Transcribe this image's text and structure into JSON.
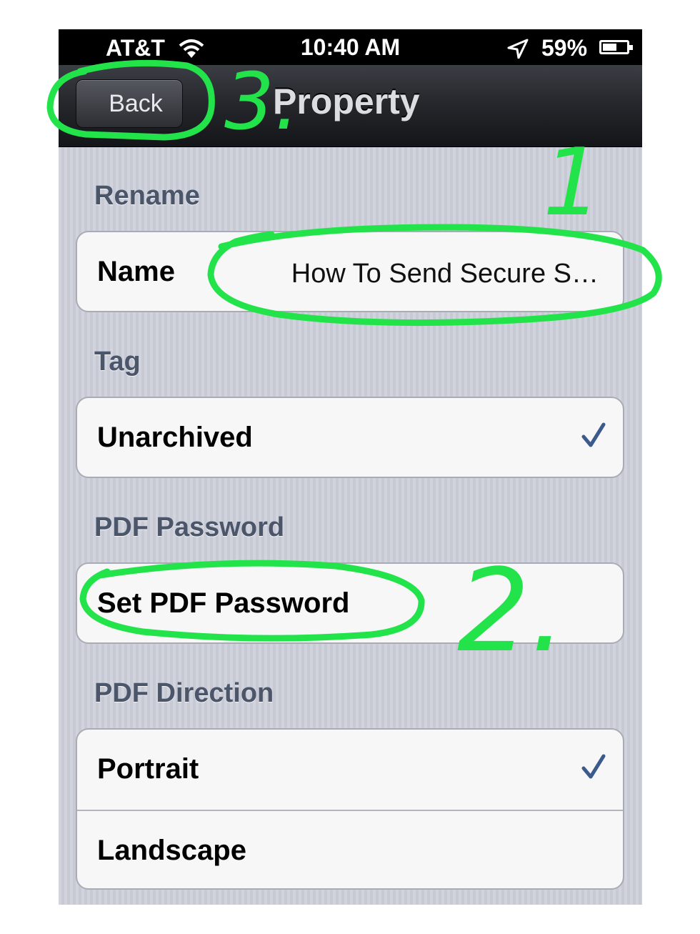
{
  "status_bar": {
    "carrier": "AT&T",
    "time": "10:40 AM",
    "battery": "59%"
  },
  "nav": {
    "back_label": "Back",
    "title": "Property"
  },
  "sections": {
    "rename": {
      "header": "Rename",
      "name_label": "Name",
      "name_value": "How To Send Secure S…"
    },
    "tag": {
      "header": "Tag",
      "option": "Unarchived",
      "checked": true
    },
    "pdf_password": {
      "header": "PDF Password",
      "action": "Set PDF Password"
    },
    "pdf_direction": {
      "header": "PDF Direction",
      "options": [
        {
          "label": "Portrait",
          "checked": true
        },
        {
          "label": "Landscape",
          "checked": false
        }
      ]
    }
  },
  "annotations": {
    "numbers": [
      "1",
      "2.",
      "3."
    ],
    "color": "#22e34a"
  },
  "colors": {
    "check": "#3c5a8c",
    "section_header": "#4c566a"
  }
}
